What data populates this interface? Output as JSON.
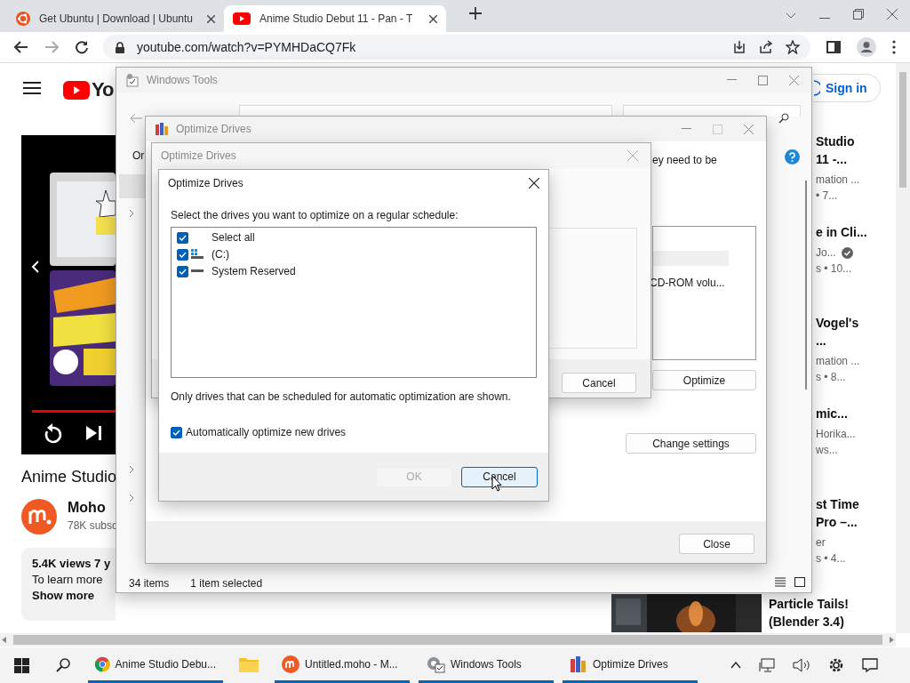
{
  "browser": {
    "tabs": [
      {
        "title": "Get Ubuntu | Download | Ubuntu",
        "kind": "ubuntu",
        "selected": false
      },
      {
        "title": "Anime Studio Debut 11 - Pan - T",
        "kind": "youtube",
        "selected": true
      }
    ],
    "url": "youtube.com/watch?v=PYMHDaCQ7Fk"
  },
  "youtube": {
    "logo": "Yo",
    "sign_in": "Sign in",
    "video": {
      "kind": "picture"
    },
    "title": "Anime Studio",
    "channel": "Moho",
    "subscribers": "78K subsc",
    "description": {
      "stats": "5.4K views  7 y",
      "text": "To learn more",
      "more": "Show more"
    },
    "recommendations": [
      {
        "title": [
          "Studio",
          "11 -..."
        ],
        "channel": "mation ...",
        "meta": "• 7...",
        "verified": false
      },
      {
        "title": [
          "e in Cli..."
        ],
        "channel": "Jo...",
        "meta": "s  • 10...",
        "verified": true
      },
      {
        "title": [
          "Vogel's",
          "..."
        ],
        "channel": "mation ...",
        "meta": "s  • 8...",
        "verified": false
      },
      {
        "title": [
          "mic..."
        ],
        "channel": "Horika...",
        "meta": "ws...",
        "verified": false
      },
      {
        "title": [
          "st Time",
          "Pro –..."
        ],
        "channel": "er",
        "meta": "s  • 4...",
        "verified": false
      }
    ],
    "last_recommendation": [
      "Particle Tails!",
      "(Blender 3.4)"
    ]
  },
  "windows_tools": {
    "title": "Windows Tools",
    "nav_text": "Or",
    "status": [
      "34 items",
      "1 item selected"
    ]
  },
  "optimize_drives": {
    "title": "Optimize Drives",
    "text": "ey need to be",
    "list_item": "CD-ROM volu...",
    "buttons": [
      "Optimize",
      "Change settings",
      "Close"
    ]
  },
  "settings_dialog": {
    "title": "Optimize Drives",
    "button": "Cancel"
  },
  "schedule_dialog": {
    "title": "Optimize Drives",
    "prompt": "Select the drives you want to optimize on a regular schedule:",
    "drives": [
      {
        "label": "Select all",
        "kind": "all",
        "checked": true
      },
      {
        "label": "(C:)",
        "kind": "system",
        "checked": true
      },
      {
        "label": "System Reserved",
        "kind": "volume",
        "checked": true
      }
    ],
    "note": "Only drives that can be scheduled for automatic optimization are shown.",
    "auto": {
      "label": "Automatically optimize new drives",
      "checked": true
    },
    "buttons": [
      {
        "label": "OK",
        "disabled": true
      },
      {
        "label": "Cancel",
        "disabled": false
      }
    ]
  },
  "taskbar": {
    "apps": [
      {
        "label": "Anime Studio Debu...",
        "kind": "chrome",
        "running": true
      },
      {
        "kind": "explorer",
        "running": false
      },
      {
        "label": "Untitled.moho - M...",
        "kind": "moho",
        "running": true
      },
      {
        "label": "Windows Tools",
        "kind": "tools",
        "running": true
      },
      {
        "label": "Optimize Drives",
        "kind": "defrag",
        "running": true
      }
    ]
  }
}
